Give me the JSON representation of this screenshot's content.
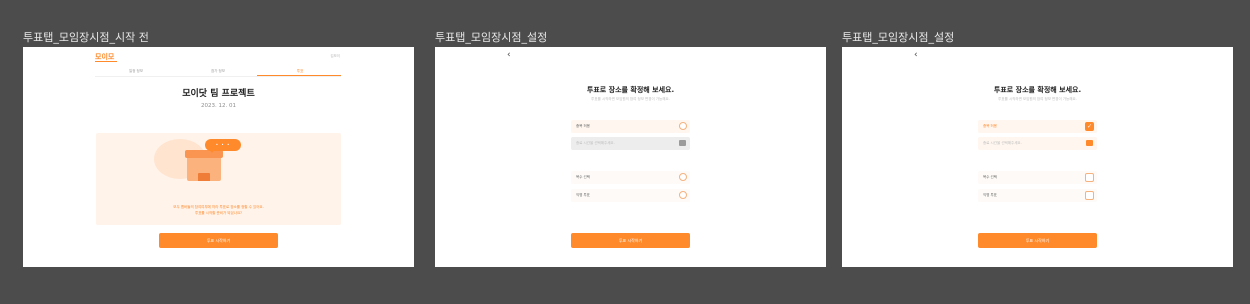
{
  "frames": [
    {
      "label": "투표탭_모임장시점_시작 전",
      "logo": "모이모",
      "user_name": "김모이",
      "tabs": [
        "일정 정보",
        "참가 정보",
        "투표"
      ],
      "project_title": "모이닷 팀 프로젝트",
      "project_date": "2023. 12. 01",
      "bubble_text": "• • •",
      "notice_line1": "모두 멤버들의 참여여부에 따라 투표로 장소를 정할 수 있어요.",
      "notice_line2": "투표를 시작할 준비가 되었나요?",
      "button": "투표 시작하기"
    },
    {
      "label": "투표탭_모임장시점_설정",
      "back_icon": "‹",
      "title": "투표로 장소를 확정해 보세요.",
      "subtitle": "투표를 시작하면 모임원의 참여 정보 변경이 가능해요.",
      "option_1": "중복 허용",
      "date_placeholder": "종료 시간을 선택해주세요.",
      "option_2": "복수 선택",
      "option_3": "익명 투표",
      "button": "투표 시작하기"
    },
    {
      "label": "투표탭_모임장시점_설정",
      "back_icon": "‹",
      "title": "투표로 장소를 확정해 보세요.",
      "subtitle": "투표를 시작하면 모임원의 참여 정보 변경이 가능해요.",
      "option_1": "중복 허용",
      "check_mark": "✓",
      "date_placeholder": "종료 시간을 선택해주세요.",
      "option_2": "복수 선택",
      "option_3": "익명 투표",
      "button": "투표 시작하기"
    }
  ],
  "colors": {
    "canvas": "#4c4c4c",
    "accent": "#ff8a2b",
    "accent_soft": "#fff3ea"
  }
}
